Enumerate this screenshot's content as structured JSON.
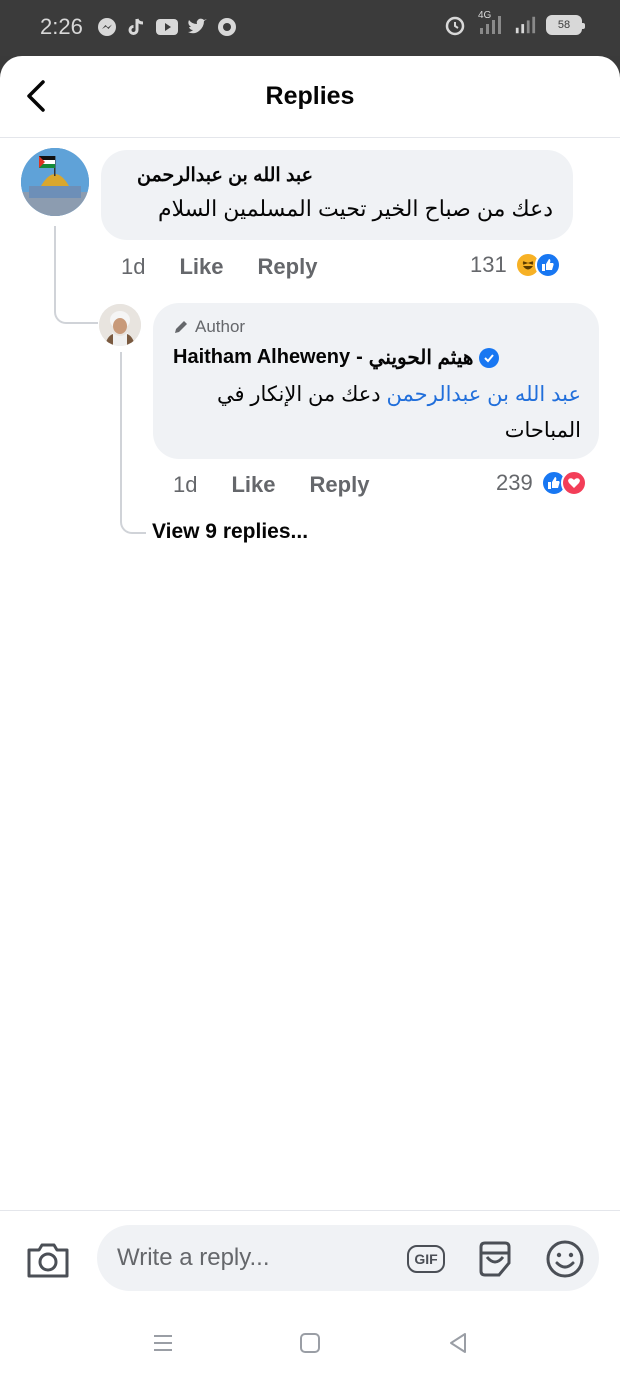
{
  "status_bar": {
    "time": "2:26",
    "network": "4G",
    "battery": "58"
  },
  "header": {
    "title": "Replies"
  },
  "comment": {
    "author": "عبد الله بن عبدالرحمن",
    "text": "دعك من صباح الخير تحيت المسلمين السلام",
    "time": "1d",
    "like_label": "Like",
    "reply_label": "Reply",
    "reaction_count": "131",
    "reactions": [
      "haha",
      "like"
    ]
  },
  "reply": {
    "badge": "Author",
    "author_en": "Haitham Alheweny",
    "author_sep": "-",
    "author_ar": "هيثم الحويني",
    "mention": "عبد الله بن عبدالرحمن",
    "text": "دعك من الإنكار في المباحات",
    "time": "1d",
    "like_label": "Like",
    "reply_label": "Reply",
    "reaction_count": "239",
    "reactions": [
      "like",
      "love"
    ]
  },
  "view_more": "View 9 replies...",
  "composer": {
    "placeholder": "Write a reply...",
    "gif_label": "GIF"
  },
  "colors": {
    "brand_blue": "#1877f2",
    "mention_blue": "#216fdb",
    "bubble_bg": "#f0f2f5",
    "secondary_text": "#65676b"
  }
}
